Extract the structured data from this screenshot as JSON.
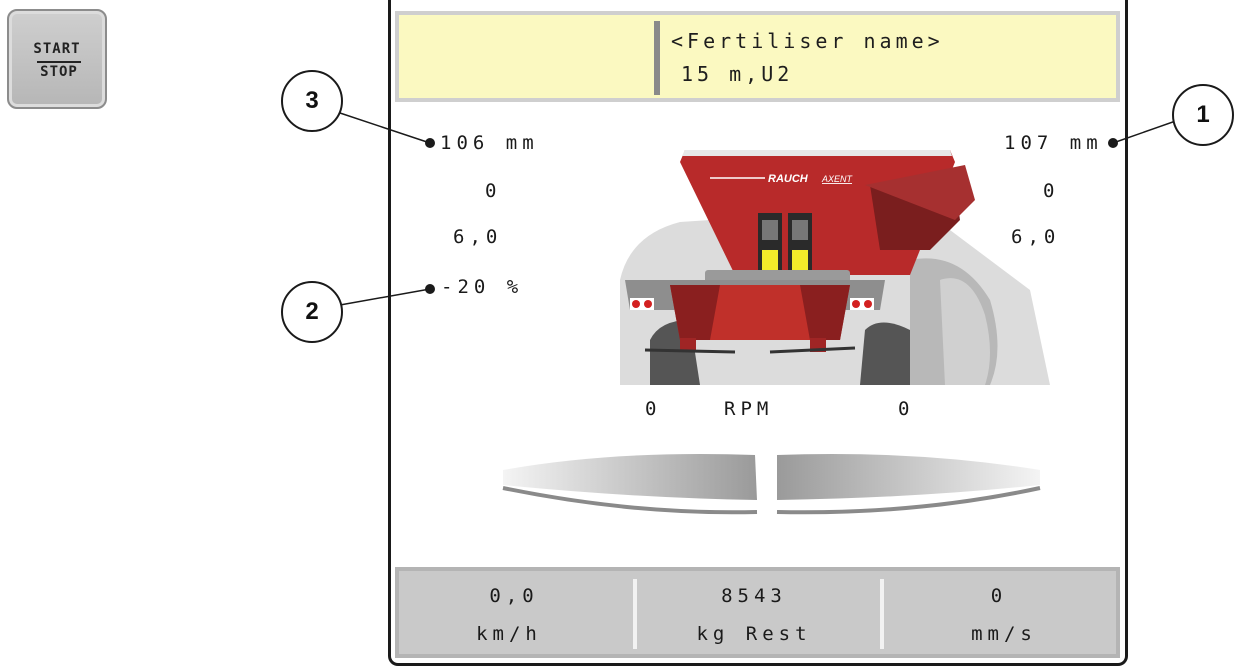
{
  "start_stop": {
    "line1": "START",
    "line2": "STOP"
  },
  "header": {
    "fertiliser_name": "<Fertiliser name>",
    "working_width": "15 m,U2"
  },
  "left": {
    "opening": "106 mm",
    "value2": "0",
    "value3": "6,0",
    "quantity_change": "-20 %"
  },
  "right": {
    "opening": "107 mm",
    "value2": "0",
    "value3": "6,0"
  },
  "rpm": {
    "left": "0",
    "label": "RPM",
    "right": "0"
  },
  "callouts": [
    "1",
    "2",
    "3"
  ],
  "machine": {
    "brand": "RAUCH",
    "model": "AXENT"
  },
  "footer": {
    "speed": {
      "value": "0,0",
      "unit": "km/h"
    },
    "rest": {
      "value": "8543",
      "unit": "kg Rest"
    },
    "flow": {
      "value": "0",
      "unit": "mm/s"
    }
  },
  "colors": {
    "header_bg": "#fbf9c1",
    "footer_bg": "#c9c9c9",
    "hopper": "#b82a2a",
    "indicator": "#f2ea2a"
  }
}
